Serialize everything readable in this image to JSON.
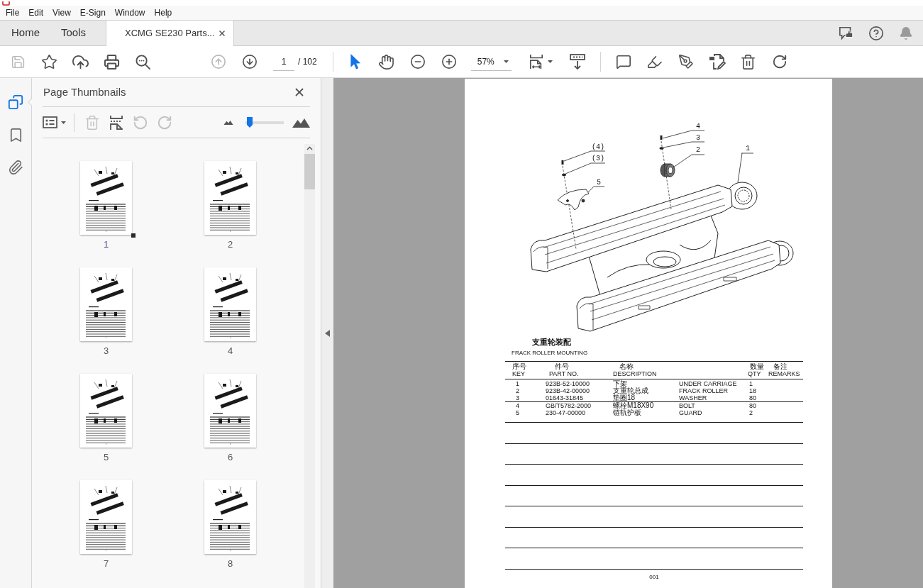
{
  "menu_bar": [
    "File",
    "Edit",
    "View",
    "E-Sign",
    "Window",
    "Help"
  ],
  "tabs": [
    {
      "label": "Home",
      "kind": "nav",
      "selected": false
    },
    {
      "label": "Tools",
      "kind": "nav",
      "selected": false
    },
    {
      "label": "XCMG SE230 Parts...",
      "kind": "document",
      "selected": true
    }
  ],
  "toolbar": {
    "file_tools": [
      {
        "kind": "save",
        "disabled": true
      },
      {
        "kind": "star",
        "disabled": false
      },
      {
        "kind": "upload",
        "disabled": false
      },
      {
        "kind": "print",
        "disabled": false
      },
      {
        "kind": "find",
        "disabled": false
      }
    ],
    "nav_tools": [
      {
        "kind": "page-up",
        "disabled": true
      },
      {
        "kind": "page-down",
        "disabled": false
      }
    ],
    "page_field": {
      "value": "1"
    },
    "page_total": "/ 102",
    "view_tools": [
      {
        "kind": "select",
        "selected": true
      },
      {
        "kind": "hand",
        "selected": false
      },
      {
        "kind": "zoom-out",
        "disabled": false
      },
      {
        "kind": "zoom-in",
        "disabled": false
      }
    ],
    "zoom_field": {
      "value": "57%"
    },
    "layout_tools": [
      {
        "kind": "fit-page",
        "disabled": false
      },
      {
        "kind": "scroll-mode",
        "disabled": false
      }
    ],
    "edit_tools": [
      {
        "kind": "comment",
        "disabled": false
      },
      {
        "kind": "highlight",
        "disabled": false
      },
      {
        "kind": "sign",
        "disabled": false
      },
      {
        "kind": "edit-pdf",
        "disabled": false
      },
      {
        "kind": "delete",
        "disabled": false
      },
      {
        "kind": "rotate",
        "disabled": false
      }
    ]
  },
  "side_rail": [
    {
      "kind": "pages",
      "selected": true
    },
    {
      "kind": "bookmarks",
      "selected": false
    },
    {
      "kind": "attachments",
      "selected": false
    }
  ],
  "thumbnail_panel": {
    "title": "Page Thumbnails",
    "tools": [
      {
        "kind": "options",
        "disabled": false
      },
      {
        "kind": "delete",
        "disabled": true
      },
      {
        "kind": "extract",
        "disabled": false
      },
      {
        "kind": "rotate-ccw",
        "disabled": true
      },
      {
        "kind": "rotate-cw",
        "disabled": true
      }
    ],
    "size_slider": {
      "level": 0.05
    },
    "thumbnails": [
      {
        "label": "1",
        "selected": true
      },
      {
        "label": "2",
        "selected": false
      },
      {
        "label": "3",
        "selected": false
      },
      {
        "label": "4",
        "selected": false
      },
      {
        "label": "5",
        "selected": false
      },
      {
        "label": "6",
        "selected": false
      },
      {
        "label": "7",
        "selected": false
      },
      {
        "label": "8",
        "selected": false
      }
    ]
  },
  "document": {
    "callouts": [
      "4",
      "3",
      "(4)",
      "2",
      "1",
      "(3)",
      "5"
    ],
    "heading": "支重轮装配",
    "subtitle": "FRACK ROLLER MOUNTING",
    "table": {
      "columns": [
        {
          "zh": "序号",
          "en": "KEY"
        },
        {
          "zh": "件号",
          "en": "PART NO."
        },
        {
          "zh": "名称",
          "en": "DESCRIPTION"
        },
        {
          "zh": "数量",
          "en": "QTY"
        },
        {
          "zh": "备注",
          "en": "REMARKS"
        }
      ],
      "rows": [
        {
          "key": "1",
          "part_no": "923B-52-10000",
          "name_zh": "下架",
          "name_en": "UNDER CARRIAGE",
          "qty": "1",
          "separator_below": false
        },
        {
          "key": "2",
          "part_no": "923B-42-00000",
          "name_zh": "支重轮总成",
          "name_en": "FRACK ROLLER",
          "qty": "18",
          "separator_below": false
        },
        {
          "key": "3",
          "part_no": "01643-31845",
          "name_zh": "垫圈18",
          "name_en": "WASHER",
          "qty": "80",
          "separator_below": true
        },
        {
          "key": "4",
          "part_no": "GB/T5782-2000",
          "name_zh": "螺栓M18X90",
          "name_en": "BOLT",
          "qty": "80",
          "separator_below": false
        },
        {
          "key": "5",
          "part_no": "230-47-00000",
          "name_zh": "链轨护板",
          "name_en": "GUARD",
          "qty": "2",
          "separator_below": false
        }
      ]
    },
    "page_number": "001"
  }
}
